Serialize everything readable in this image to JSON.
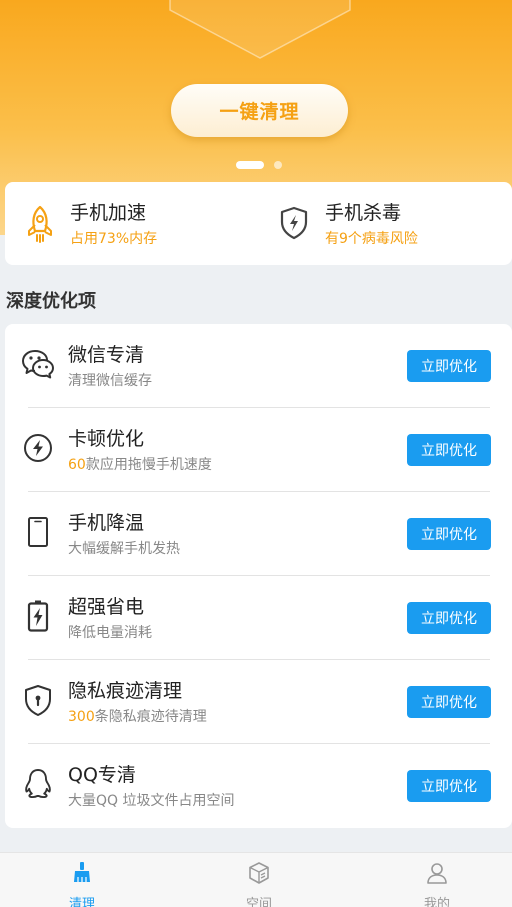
{
  "hero": {
    "clean_button": "一键清理",
    "carousel_pages": 2,
    "carousel_active": 1,
    "colors": {
      "top": "#f9a81e",
      "bottom": "#fcd68b",
      "accent": "#f5a114"
    }
  },
  "quick_actions": [
    {
      "title": "手机加速",
      "subtitle": "占用73%内存",
      "icon": "rocket-icon"
    },
    {
      "title": "手机杀毒",
      "subtitle": "有9个病毒风险",
      "icon": "shield-bolt-icon"
    }
  ],
  "section": {
    "title": "深度优化项"
  },
  "items": [
    {
      "title": "微信专清",
      "sub_highlight": "",
      "sub_text": "清理微信缓存",
      "button": "立即优化",
      "icon": "wechat-icon"
    },
    {
      "title": "卡顿优化",
      "sub_highlight": "60",
      "sub_text": "款应用拖慢手机速度",
      "button": "立即优化",
      "icon": "lightning-circle-icon"
    },
    {
      "title": "手机降温",
      "sub_highlight": "",
      "sub_text": "大幅缓解手机发热",
      "button": "立即优化",
      "icon": "phone-icon"
    },
    {
      "title": "超强省电",
      "sub_highlight": "",
      "sub_text": "降低电量消耗",
      "button": "立即优化",
      "icon": "battery-icon"
    },
    {
      "title": "隐私痕迹清理",
      "sub_highlight": "300",
      "sub_text": "条隐私痕迹待清理",
      "button": "立即优化",
      "icon": "privacy-shield-icon"
    },
    {
      "title": "QQ专清",
      "sub_highlight": "",
      "sub_text": "大量QQ 垃圾文件占用空间",
      "button": "立即优化",
      "icon": "qq-penguin-icon"
    }
  ],
  "tabbar": {
    "tabs": [
      {
        "label": "清理",
        "icon": "broom-icon",
        "active": true
      },
      {
        "label": "空间",
        "icon": "box-icon",
        "active": false
      },
      {
        "label": "我的",
        "icon": "user-icon",
        "active": false
      }
    ],
    "active_color": "#1a9cf0"
  }
}
